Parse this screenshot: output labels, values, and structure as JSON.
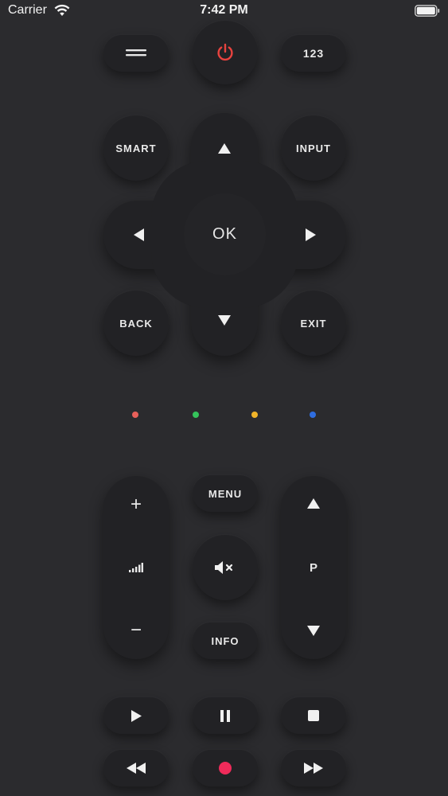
{
  "status_bar": {
    "carrier": "Carrier",
    "time": "7:42 PM"
  },
  "top_row": {
    "menu_icon": "hamburger-icon",
    "power_icon": "power-icon",
    "numpad_label": "123"
  },
  "nav": {
    "smart_label": "SMART",
    "input_label": "INPUT",
    "back_label": "BACK",
    "exit_label": "EXIT",
    "ok_label": "OK"
  },
  "color_dots": [
    {
      "name": "red",
      "color": "#e8605a"
    },
    {
      "name": "green",
      "color": "#35c35b"
    },
    {
      "name": "yellow",
      "color": "#f0b429"
    },
    {
      "name": "blue",
      "color": "#2f6de0"
    }
  ],
  "volume": {
    "plus": "+",
    "minus": "−"
  },
  "center_column": {
    "menu_label": "MENU",
    "info_label": "INFO"
  },
  "program": {
    "label": "P"
  },
  "playback": {
    "play_icon": "play-icon",
    "pause_icon": "pause-icon",
    "stop_icon": "stop-icon",
    "rewind_icon": "rewind-icon",
    "record_icon": "record-icon",
    "forward_icon": "fast-forward-icon"
  },
  "colors": {
    "background": "#2b2b2e",
    "button": "#222225",
    "power": "#e8433f",
    "record": "#ef2b5a"
  }
}
